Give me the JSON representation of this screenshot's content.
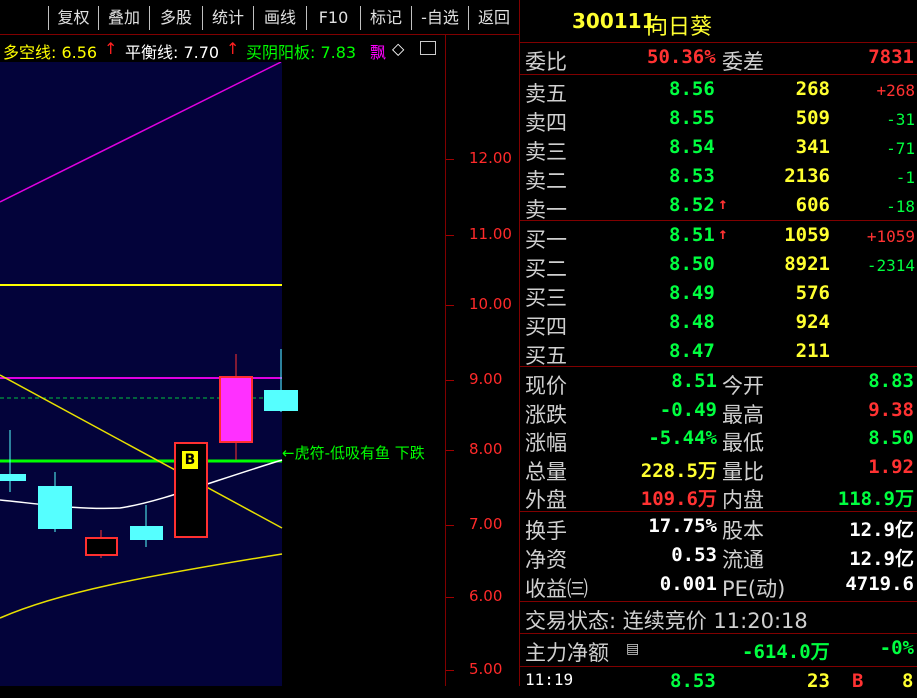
{
  "toolbar": [
    "复权",
    "叠加",
    "多股",
    "统计",
    "画线",
    "F10",
    "标记",
    "-自选",
    "返回"
  ],
  "indicators": {
    "dk_label": "多空线: 6.56",
    "ph_label": "平衡线: 7.70",
    "mb_label": "买阴阳板: 7.83",
    "extra_label": "飘",
    "extra_icon": "◇"
  },
  "chart_data": {
    "type": "candlestick",
    "y_ticks": [
      "12.00",
      "11.00",
      "10.00",
      "9.00",
      "8.00",
      "7.00",
      "6.00",
      "5.00"
    ],
    "signal_text": "←虎符-低吸有鱼 下跌",
    "buy_marker": "B"
  },
  "quote": {
    "code": "300111",
    "name": "向日葵",
    "weibi_label": "委比",
    "weibi_value": "50.36%",
    "weicha_label": "委差",
    "weicha_value": "7831",
    "sell": [
      {
        "label": "卖五",
        "price": "8.56",
        "vol": "268",
        "chg": "+268",
        "arrow": ""
      },
      {
        "label": "卖四",
        "price": "8.55",
        "vol": "509",
        "chg": "-31",
        "arrow": ""
      },
      {
        "label": "卖三",
        "price": "8.54",
        "vol": "341",
        "chg": "-71",
        "arrow": ""
      },
      {
        "label": "卖二",
        "price": "8.53",
        "vol": "2136",
        "chg": "-1",
        "arrow": ""
      },
      {
        "label": "卖一",
        "price": "8.52",
        "vol": "606",
        "chg": "-18",
        "arrow": "↑"
      }
    ],
    "buy": [
      {
        "label": "买一",
        "price": "8.51",
        "vol": "1059",
        "chg": "+1059",
        "arrow": "↑"
      },
      {
        "label": "买二",
        "price": "8.50",
        "vol": "8921",
        "chg": "-2314",
        "arrow": ""
      },
      {
        "label": "买三",
        "price": "8.49",
        "vol": "576",
        "chg": "",
        "arrow": ""
      },
      {
        "label": "买四",
        "price": "8.48",
        "vol": "924",
        "chg": "",
        "arrow": ""
      },
      {
        "label": "买五",
        "price": "8.47",
        "vol": "211",
        "chg": "",
        "arrow": ""
      }
    ],
    "stats": [
      {
        "l1": "现价",
        "v1": "8.51",
        "c1": "green",
        "l2": "今开",
        "v2": "8.83",
        "c2": "green"
      },
      {
        "l1": "涨跌",
        "v1": "-0.49",
        "c1": "green",
        "l2": "最高",
        "v2": "9.38",
        "c2": "red"
      },
      {
        "l1": "涨幅",
        "v1": "-5.44%",
        "c1": "green",
        "l2": "最低",
        "v2": "8.50",
        "c2": "green"
      },
      {
        "l1": "总量",
        "v1": "228.5万",
        "c1": "yel",
        "l2": "量比",
        "v2": "1.92",
        "c2": "red"
      },
      {
        "l1": "外盘",
        "v1": "109.6万",
        "c1": "red",
        "l2": "内盘",
        "v2": "118.9万",
        "c2": "green"
      }
    ],
    "stats2": [
      {
        "l1": "换手",
        "v1": "17.75%",
        "l2": "股本",
        "v2": "12.9亿"
      },
      {
        "l1": "净资",
        "v1": "0.53",
        "l2": "流通",
        "v2": "12.9亿"
      },
      {
        "l1": "收益㈢",
        "v1": "0.001",
        "l2": "PE(动)",
        "v2": "4719.6"
      }
    ],
    "status": "交易状态: 连续竞价 11:20:18",
    "main_label": "主力净额",
    "main_value": "-614.0万",
    "main_pct": "-0%",
    "tick": {
      "time": "11:19",
      "price": "8.53",
      "vol": "23",
      "side": "B",
      "extra": "8"
    }
  }
}
